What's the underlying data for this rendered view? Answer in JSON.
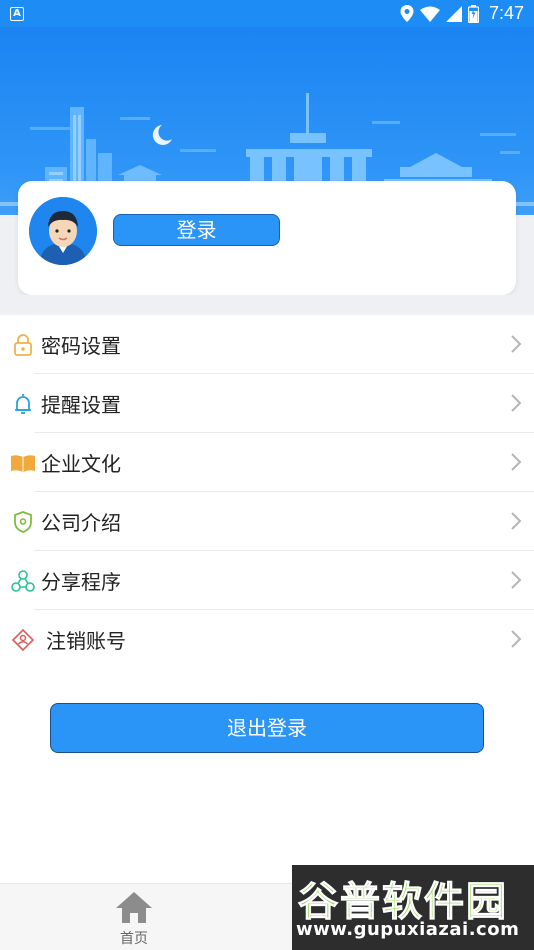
{
  "status_bar": {
    "app_icon_letter": "A",
    "time": "7:47"
  },
  "profile": {
    "login_label": "登录"
  },
  "menu": {
    "items": [
      {
        "label": "密码设置",
        "icon": "lock-icon",
        "color": "#f0b24a"
      },
      {
        "label": "提醒设置",
        "icon": "bell-icon",
        "color": "#2aa4d8"
      },
      {
        "label": "企业文化",
        "icon": "book-icon",
        "color": "#f2a93b"
      },
      {
        "label": "公司介绍",
        "icon": "shield-icon",
        "color": "#7dbf3d"
      },
      {
        "label": "分享程序",
        "icon": "share-icon",
        "color": "#27c29a"
      },
      {
        "label": "注销账号",
        "icon": "user-diamond-icon",
        "color": "#e05b5b"
      }
    ]
  },
  "logout": {
    "label": "退出登录"
  },
  "bottom_nav": {
    "home_label": "首页"
  },
  "watermark": {
    "brand": "谷普软件园",
    "url": "www.gupuxiazai.com"
  },
  "colors": {
    "primary": "#2b94f7",
    "header": "#1b84f2",
    "background": "#eef0f4"
  }
}
